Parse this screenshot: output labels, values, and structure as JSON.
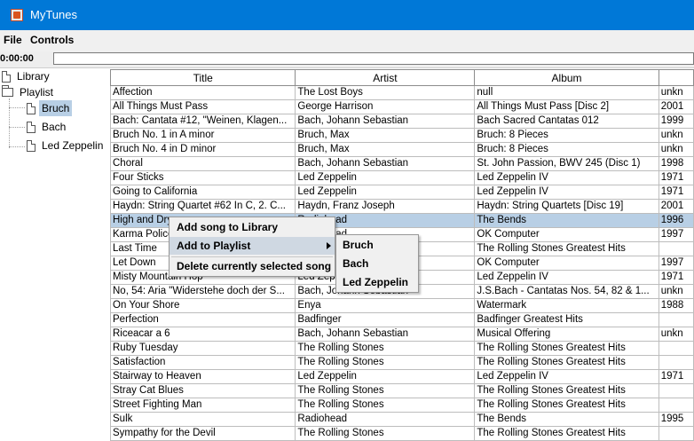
{
  "window": {
    "title": "MyTunes",
    "icon": "java-cup-icon",
    "accent": "#0078d7"
  },
  "menu": {
    "file": "File",
    "controls": "Controls"
  },
  "player": {
    "time": "0:00:00"
  },
  "tree": {
    "library": "Library",
    "playlist": "Playlist",
    "playlists": [
      "Bruch",
      "Bach",
      "Led Zeppelin"
    ],
    "selected": "Bruch"
  },
  "table": {
    "columns": [
      "Title",
      "Artist",
      "Album",
      ""
    ],
    "rows": [
      [
        "Affection",
        "The Lost Boys",
        "null",
        "unkn"
      ],
      [
        "All Things Must Pass",
        "George Harrison",
        "All Things Must Pass [Disc 2]",
        "2001"
      ],
      [
        "Bach: Cantata #12, \"Weinen, Klagen...",
        "Bach, Johann Sebastian",
        "Bach Sacred Cantatas 012",
        "1999"
      ],
      [
        "Bruch No. 1 in A minor",
        "Bruch, Max",
        "Bruch: 8 Pieces",
        "unkn"
      ],
      [
        "Bruch No. 4 in D minor",
        "Bruch, Max",
        "Bruch: 8 Pieces",
        "unkn"
      ],
      [
        "Choral",
        "Bach, Johann Sebastian",
        "St. John Passion, BWV 245 (Disc 1)",
        "1998"
      ],
      [
        "Four Sticks",
        "Led Zeppelin",
        "Led Zeppelin IV",
        "1971"
      ],
      [
        "Going to California",
        "Led Zeppelin",
        "Led Zeppelin IV",
        "1971"
      ],
      [
        "Haydn: String Quartet #62 In C, 2. C...",
        "Haydn, Franz Joseph",
        "Haydn: String Quartets [Disc 19]",
        "2001"
      ],
      [
        "High and Dry",
        "Radiohead",
        "The Bends",
        "1996"
      ],
      [
        "Karma Police",
        "Radiohead",
        "OK Computer",
        "1997"
      ],
      [
        "Last Time",
        "The Rolling Stones",
        "The Rolling Stones Greatest Hits",
        ""
      ],
      [
        "Let Down",
        "Radiohead",
        "OK Computer",
        "1997"
      ],
      [
        "Misty Mountain Hop",
        "Led Zeppelin",
        "Led Zeppelin IV",
        "1971"
      ],
      [
        "No, 54: Aria \"Widerstehe doch der S...",
        "Bach, Johann Sebastian",
        "J.S.Bach - Cantatas Nos. 54, 82 & 1...",
        "unkn"
      ],
      [
        "On Your Shore",
        "Enya",
        "Watermark",
        "1988"
      ],
      [
        "Perfection",
        "Badfinger",
        "Badfinger Greatest Hits",
        ""
      ],
      [
        "Riceacar a 6",
        "Bach, Johann Sebastian",
        "Musical Offering",
        "unkn"
      ],
      [
        "Ruby Tuesday",
        "The Rolling Stones",
        "The Rolling Stones Greatest Hits",
        ""
      ],
      [
        "Satisfaction",
        "The Rolling Stones",
        "The Rolling Stones Greatest Hits",
        ""
      ],
      [
        "Stairway to Heaven",
        "Led Zeppelin",
        "Led Zeppelin IV",
        "1971"
      ],
      [
        "Stray Cat Blues",
        "The Rolling Stones",
        "The Rolling Stones Greatest Hits",
        ""
      ],
      [
        "Street Fighting Man",
        "The Rolling Stones",
        "The Rolling Stones Greatest Hits",
        ""
      ],
      [
        "Sulk",
        "Radiohead",
        "The Bends",
        "1995"
      ],
      [
        "Sympathy for the Devil",
        "The Rolling Stones",
        "The Rolling Stones Greatest Hits",
        ""
      ]
    ],
    "selected_row": 9
  },
  "context_menu": {
    "items": [
      "Add song to Library",
      "Add to Playlist",
      "Delete currently selected song"
    ],
    "submenu": [
      "Bruch",
      "Bach",
      "Led Zeppelin"
    ]
  }
}
